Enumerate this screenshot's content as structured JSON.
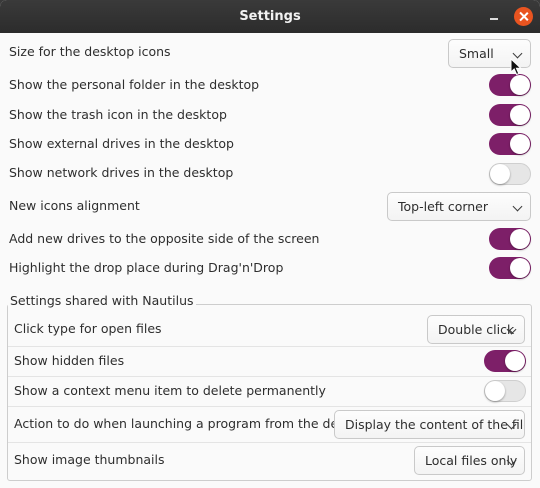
{
  "window": {
    "title": "Settings"
  },
  "rows": [
    {
      "label": "Size for the desktop icons",
      "control": "combo",
      "value": "Small"
    },
    {
      "label": "Show the personal folder in the desktop",
      "control": "switch",
      "on": true
    },
    {
      "label": "Show the trash icon in the desktop",
      "control": "switch",
      "on": true
    },
    {
      "label": "Show external drives in the desktop",
      "control": "switch",
      "on": true
    },
    {
      "label": "Show network drives in the desktop",
      "control": "switch",
      "on": false
    },
    {
      "label": "New icons alignment",
      "control": "combo",
      "value": "Top-left corner"
    },
    {
      "label": "Add new drives to the opposite side of the screen",
      "control": "switch",
      "on": true
    },
    {
      "label": "Highlight the drop place during Drag'n'Drop",
      "control": "switch",
      "on": true
    }
  ],
  "nautilus": {
    "title": "Settings shared with Nautilus",
    "rows": [
      {
        "label": "Click type for open files",
        "control": "combo",
        "value": "Double click"
      },
      {
        "label": "Show hidden files",
        "control": "switch",
        "on": true
      },
      {
        "label": "Show a context menu item to delete permanently",
        "control": "switch",
        "on": false
      },
      {
        "label": "Action to do when launching a program from the desktop",
        "control": "combo",
        "value": "Display the content of the file"
      },
      {
        "label": "Show image thumbnails",
        "control": "combo",
        "value": "Local files only"
      }
    ]
  },
  "colors": {
    "accent": "#7d1f68",
    "close": "#e95420",
    "titlebar": "#2c2c2c"
  },
  "icons": [
    "minimize-icon",
    "close-icon",
    "chevron-down-icon",
    "mouse-pointer-icon"
  ]
}
